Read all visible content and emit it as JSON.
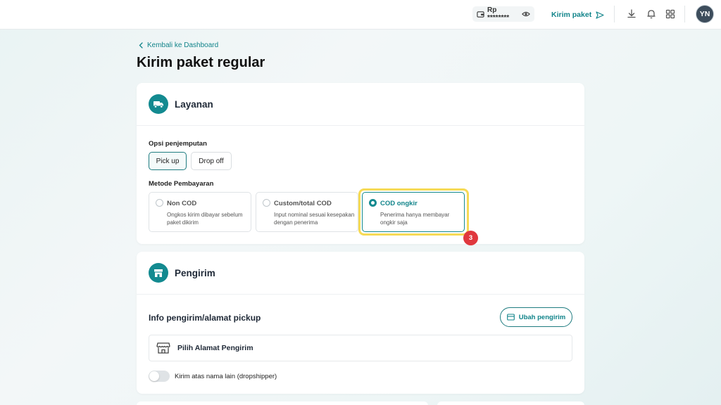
{
  "topbar": {
    "balance_label": "Rp ********",
    "send_label": "Kirim paket",
    "avatar_initials": "YN",
    "icons": [
      "wallet-icon",
      "eye-icon",
      "send-icon",
      "download-icon",
      "bell-icon",
      "apps-grid-icon"
    ]
  },
  "header": {
    "back_label": "Kembali ke Dashboard",
    "page_title": "Kirim paket regular"
  },
  "layanan": {
    "title": "Layanan",
    "pickup_label": "Opsi penjemputan",
    "pickup_options": [
      "Pick up",
      "Drop off"
    ],
    "pickup_selected": "Pick up",
    "payment_label": "Metode Pembayaran",
    "payment_options": [
      {
        "title": "Non COD",
        "desc": "Ongkos kirim dibayar sebelum paket dikirim"
      },
      {
        "title": "Custom/total COD",
        "desc": "Input nominal sesuai kesepakan dengan penerima"
      },
      {
        "title": "COD ongkir",
        "desc": "Penerima hanya membayar ongkir saja"
      }
    ],
    "payment_selected": "COD ongkir",
    "step_badge": "3"
  },
  "pengirim": {
    "title": "Pengirim",
    "info_title": "Info pengirim/alamat pickup",
    "change_button": "Ubah pengirim",
    "address_placeholder": "Pilih Alamat Pengirim",
    "dropship_label": "Kirim atas nama lain (dropshipper)",
    "dropship_on": false
  },
  "colors": {
    "accent": "#138a90",
    "highlight": "#f6da55",
    "badge": "#e0383e"
  }
}
